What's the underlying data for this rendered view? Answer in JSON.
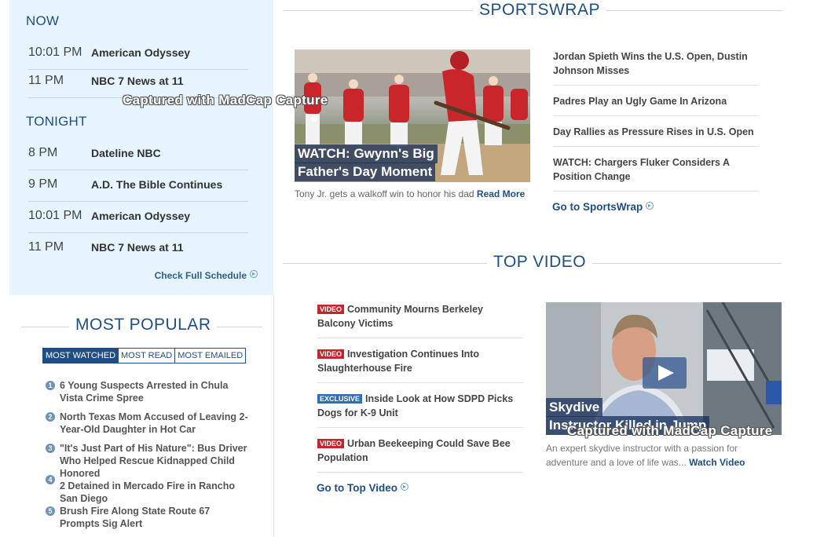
{
  "schedule": {
    "now_heading": "NOW",
    "now": [
      {
        "time": "10:01 PM",
        "show": "American Odyssey"
      },
      {
        "time": "11 PM",
        "show": "NBC 7 News at 11"
      }
    ],
    "tonight_heading": "TONIGHT",
    "tonight": [
      {
        "time": "8 PM",
        "show": "Dateline NBC"
      },
      {
        "time": "9 PM",
        "show": "A.D. The Bible Continues"
      },
      {
        "time": "10:01 PM",
        "show": "American Odyssey"
      },
      {
        "time": "11 PM",
        "show": "NBC 7 News at 11"
      }
    ],
    "full_link": "Check Full Schedule"
  },
  "most_popular": {
    "title": "MOST POPULAR",
    "tabs": [
      "MOST WATCHED",
      "MOST READ",
      "MOST EMAILED"
    ],
    "items": [
      {
        "num": "1",
        "text": "6 Young Suspects Arrested in Chula Vista Crime Spree"
      },
      {
        "num": "2",
        "text": "North Texas Mom Accused of Leaving 2-Year-Old Daughter in Hot Car"
      },
      {
        "num": "3",
        "text": "\"It's Just Part of His Nature\": Bus Driver Who Helped Rescue Kidnapped Child Honored"
      },
      {
        "num": "4",
        "text": "2 Detained in Mercado Fire in Rancho San Diego"
      },
      {
        "num": "5",
        "text": "Brush Fire Along State Route 67 Prompts Sig Alert"
      }
    ]
  },
  "sportswrap": {
    "title": "SPORTSWRAP",
    "photo_caption_line1": "WATCH: Gwynn's Big",
    "photo_caption_line2": "Father's Day Moment",
    "subcaption": "Tony Jr. gets a walkoff win to honor his dad",
    "read_more": "Read More",
    "stories": [
      "Jordan Spieth Wins the U.S. Open, Dustin Johnson Misses",
      "Padres Play an Ugly Game In Arizona",
      "Day Rallies as Pressure Rises in U.S. Open",
      "WATCH: Chargers Fluker Considers A Position Change"
    ],
    "goto": "Go to SportsWrap"
  },
  "top_video": {
    "title": "TOP VIDEO",
    "stories": [
      {
        "badge": "VIDEO",
        "text": "Community Mourns Berkeley Balcony Victims"
      },
      {
        "badge": "VIDEO",
        "text": "Investigation Continues Into Slaughterhouse Fire"
      },
      {
        "badge": "EXCLUSIVE",
        "text": "Inside Look at How SDPD Picks Dogs for K-9 Unit"
      },
      {
        "badge": "VIDEO",
        "text": "Urban Beekeeping Could Save Bee Population"
      }
    ],
    "goto": "Go to Top Video",
    "photo_caption_line1": "Skydive",
    "photo_caption_line2": "Instructor Killed in Jump",
    "subcaption": "An expert skydive instructor with a passion for adventure and a love of life was...",
    "watch_video": "Watch Video"
  },
  "watermark": "Captured with MadCap Capture",
  "colors": {
    "accent": "#1f4e86",
    "schedule_bg": "#e6f4fd",
    "badge_video": "#c1272d",
    "badge_exclusive": "#2f6fb1"
  }
}
